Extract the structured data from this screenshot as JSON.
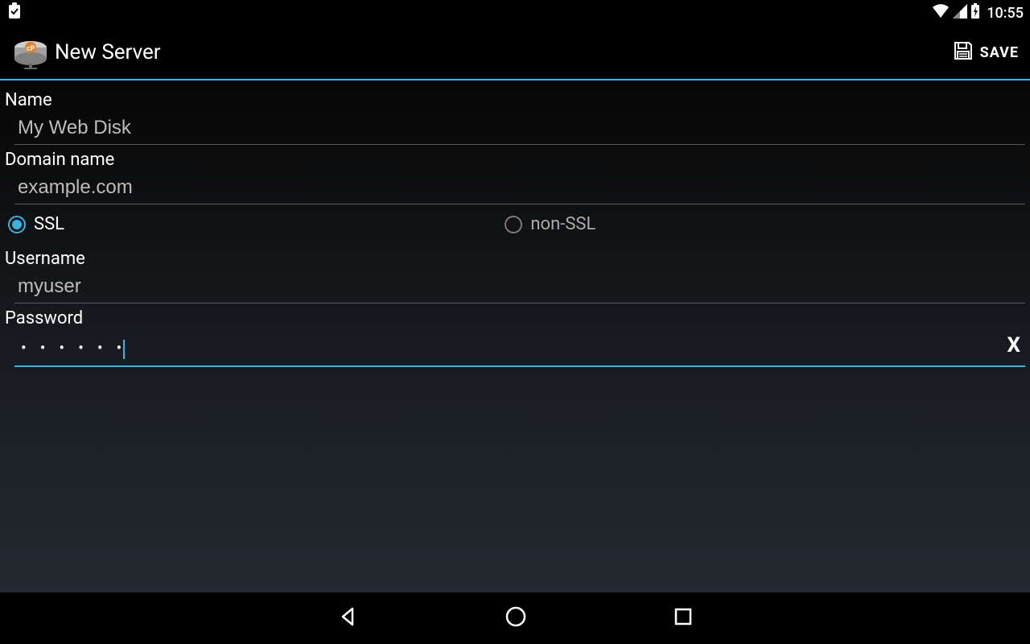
{
  "status": {
    "time": "10:55"
  },
  "header": {
    "title": "New Server",
    "save_label": "SAVE"
  },
  "form": {
    "name_label": "Name",
    "name_value": "My Web Disk",
    "domain_label": "Domain name",
    "domain_value": "example.com",
    "ssl_label": "SSL",
    "nonssl_label": "non-SSL",
    "ssl_selected": true,
    "username_label": "Username",
    "username_value": "myuser",
    "password_label": "Password",
    "password_masked": "• • • • • •",
    "clear_label": "X"
  },
  "colors": {
    "accent": "#33b5e5"
  }
}
